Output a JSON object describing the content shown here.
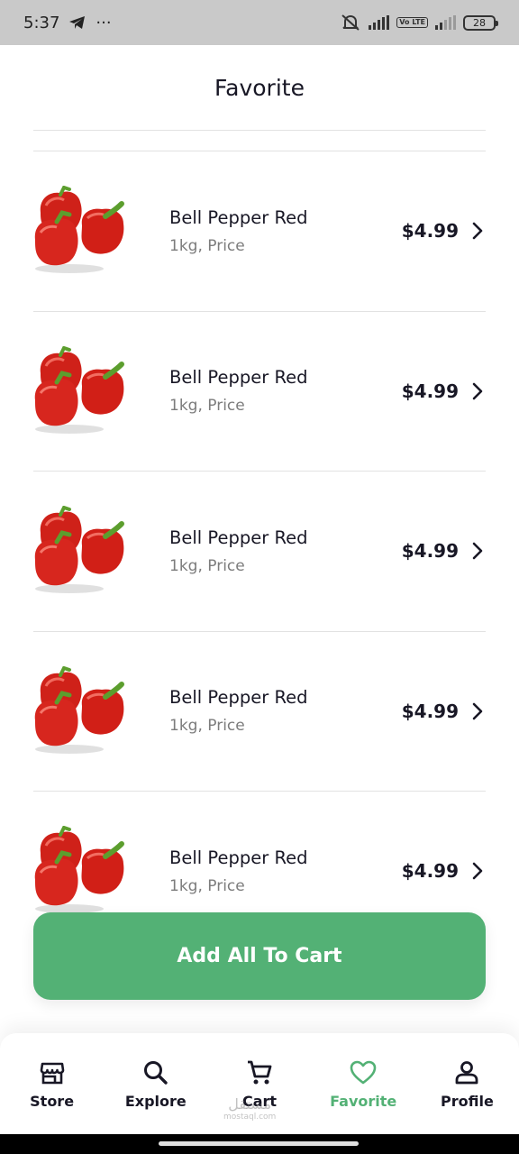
{
  "status_bar": {
    "time": "5:37",
    "dots": "···",
    "battery": "28",
    "network": "Vo LTE"
  },
  "header": {
    "title": "Favorite"
  },
  "items": [
    {
      "name": "Bell Pepper Red",
      "unit": "1kg, Price",
      "price": "$4.99",
      "image_icon": "bell-pepper-image"
    },
    {
      "name": "Bell Pepper Red",
      "unit": "1kg, Price",
      "price": "$4.99",
      "image_icon": "bell-pepper-image"
    },
    {
      "name": "Bell Pepper Red",
      "unit": "1kg, Price",
      "price": "$4.99",
      "image_icon": "bell-pepper-image"
    },
    {
      "name": "Bell Pepper Red",
      "unit": "1kg, Price",
      "price": "$4.99",
      "image_icon": "bell-pepper-image"
    },
    {
      "name": "Bell Pepper Red",
      "unit": "1kg, Price",
      "price": "$4.99",
      "image_icon": "bell-pepper-image"
    }
  ],
  "action": {
    "add_all_label": "Add All To Cart"
  },
  "nav": {
    "items": [
      {
        "label": "Store",
        "icon": "store-icon",
        "active": false
      },
      {
        "label": "Explore",
        "icon": "search-icon",
        "active": false
      },
      {
        "label": "Cart",
        "icon": "cart-icon",
        "active": false
      },
      {
        "label": "Favorite",
        "icon": "heart-icon",
        "active": true
      },
      {
        "label": "Profile",
        "icon": "profile-icon",
        "active": false
      }
    ]
  },
  "watermark": {
    "arabic": "مستقل",
    "latin": "mostaql.com"
  },
  "colors": {
    "accent": "#53b175",
    "text": "#181725",
    "muted": "#7c7c7c",
    "divider": "#e2e2e2",
    "pepper": "#d7261e",
    "stem": "#5c9e2e"
  }
}
